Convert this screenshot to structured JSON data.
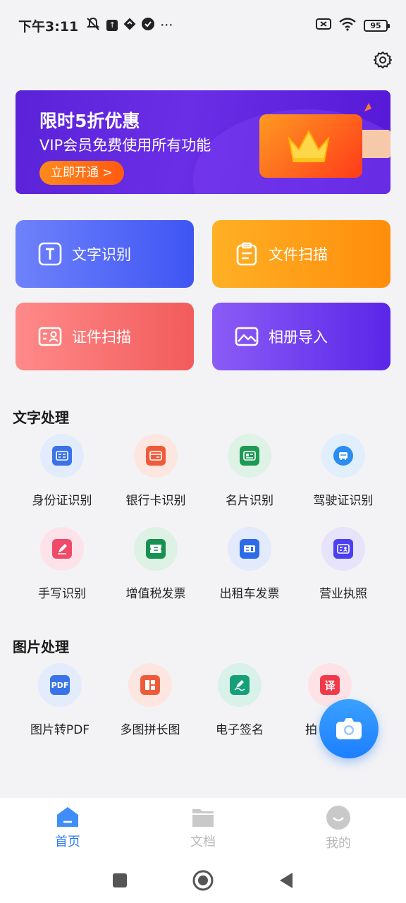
{
  "status_bar": {
    "time": "下午3:11",
    "ellipsis": "···",
    "battery": "95"
  },
  "banner": {
    "title": "限时5折优惠",
    "subtitle": "VIP会员免费使用所有功能",
    "cta": "立即开通 >"
  },
  "tiles": [
    {
      "label": "文字识别",
      "icon": "text-recognition-icon"
    },
    {
      "label": "文件扫描",
      "icon": "document-scan-icon"
    },
    {
      "label": "证件扫描",
      "icon": "id-card-scan-icon"
    },
    {
      "label": "相册导入",
      "icon": "album-import-icon"
    }
  ],
  "text_processing": {
    "title": "文字处理",
    "items": [
      {
        "label": "身份证识别",
        "icon": "id-card-icon",
        "color": "#3a73e8",
        "bg": "#e3ecfc"
      },
      {
        "label": "银行卡识别",
        "icon": "bank-card-icon",
        "color": "#ef5a3a",
        "bg": "#fde6e0"
      },
      {
        "label": "名片识别",
        "icon": "business-card-icon",
        "color": "#1e9a55",
        "bg": "#dff2e6"
      },
      {
        "label": "驾驶证识别",
        "icon": "driver-license-icon",
        "color": "#2a8df0",
        "bg": "#e1eefc"
      },
      {
        "label": "手写识别",
        "icon": "handwriting-icon",
        "color": "#f04a6a",
        "bg": "#fde3e9"
      },
      {
        "label": "增值税发票",
        "icon": "vat-invoice-icon",
        "color": "#169150",
        "bg": "#ddf1e4"
      },
      {
        "label": "出租车发票",
        "icon": "taxi-invoice-icon",
        "color": "#2d6be8",
        "bg": "#e2eafc"
      },
      {
        "label": "营业执照",
        "icon": "business-license-icon",
        "color": "#4b3ff0",
        "bg": "#e6e3fb"
      }
    ]
  },
  "image_processing": {
    "title": "图片处理",
    "items": [
      {
        "label": "图片转PDF",
        "icon": "pdf-icon",
        "glyph": "PDF",
        "color": "#3a73e8",
        "bg": "#e3ecfc"
      },
      {
        "label": "多图拼长图",
        "icon": "collage-icon",
        "color": "#ef5a3a",
        "bg": "#fde6e0"
      },
      {
        "label": "电子签名",
        "icon": "signature-icon",
        "color": "#16a07a",
        "bg": "#d8f2ea"
      },
      {
        "label": "拍",
        "icon": "translate-icon",
        "glyph": "译",
        "color": "#f03a4a",
        "bg": "#fde3e6"
      }
    ]
  },
  "tabbar": [
    {
      "label": "首页",
      "icon": "home-icon",
      "active": true
    },
    {
      "label": "文档",
      "icon": "folder-icon",
      "active": false
    },
    {
      "label": "我的",
      "icon": "profile-icon",
      "active": false
    }
  ]
}
